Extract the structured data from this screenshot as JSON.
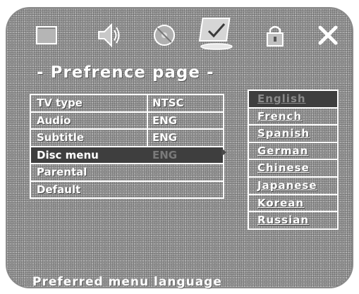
{
  "icons": [
    {
      "name": "monitor-icon"
    },
    {
      "name": "speaker-icon"
    },
    {
      "name": "disc-icon"
    },
    {
      "name": "preference-icon",
      "active": true
    },
    {
      "name": "lock-icon"
    },
    {
      "name": "close-icon"
    }
  ],
  "page": {
    "title": "- Prefrence page -"
  },
  "menu": {
    "rows": [
      {
        "label": "TV type",
        "value": "NTSC"
      },
      {
        "label": "Audio",
        "value": "ENG"
      },
      {
        "label": "Subtitle",
        "value": "ENG"
      },
      {
        "label": "Disc menu",
        "value": "ENG",
        "selected": true
      },
      {
        "label": "Parental",
        "value": ""
      },
      {
        "label": "Default",
        "value": ""
      }
    ]
  },
  "languages": {
    "selected": "English",
    "options": [
      "English",
      "French",
      "Spanish",
      "German",
      "Chinese",
      "Japanese",
      "Korean",
      "Russian"
    ]
  },
  "status": {
    "text": "Preferred menu language"
  },
  "colors": {
    "highlight": "#3e3e3e",
    "text": "#ffffff"
  }
}
